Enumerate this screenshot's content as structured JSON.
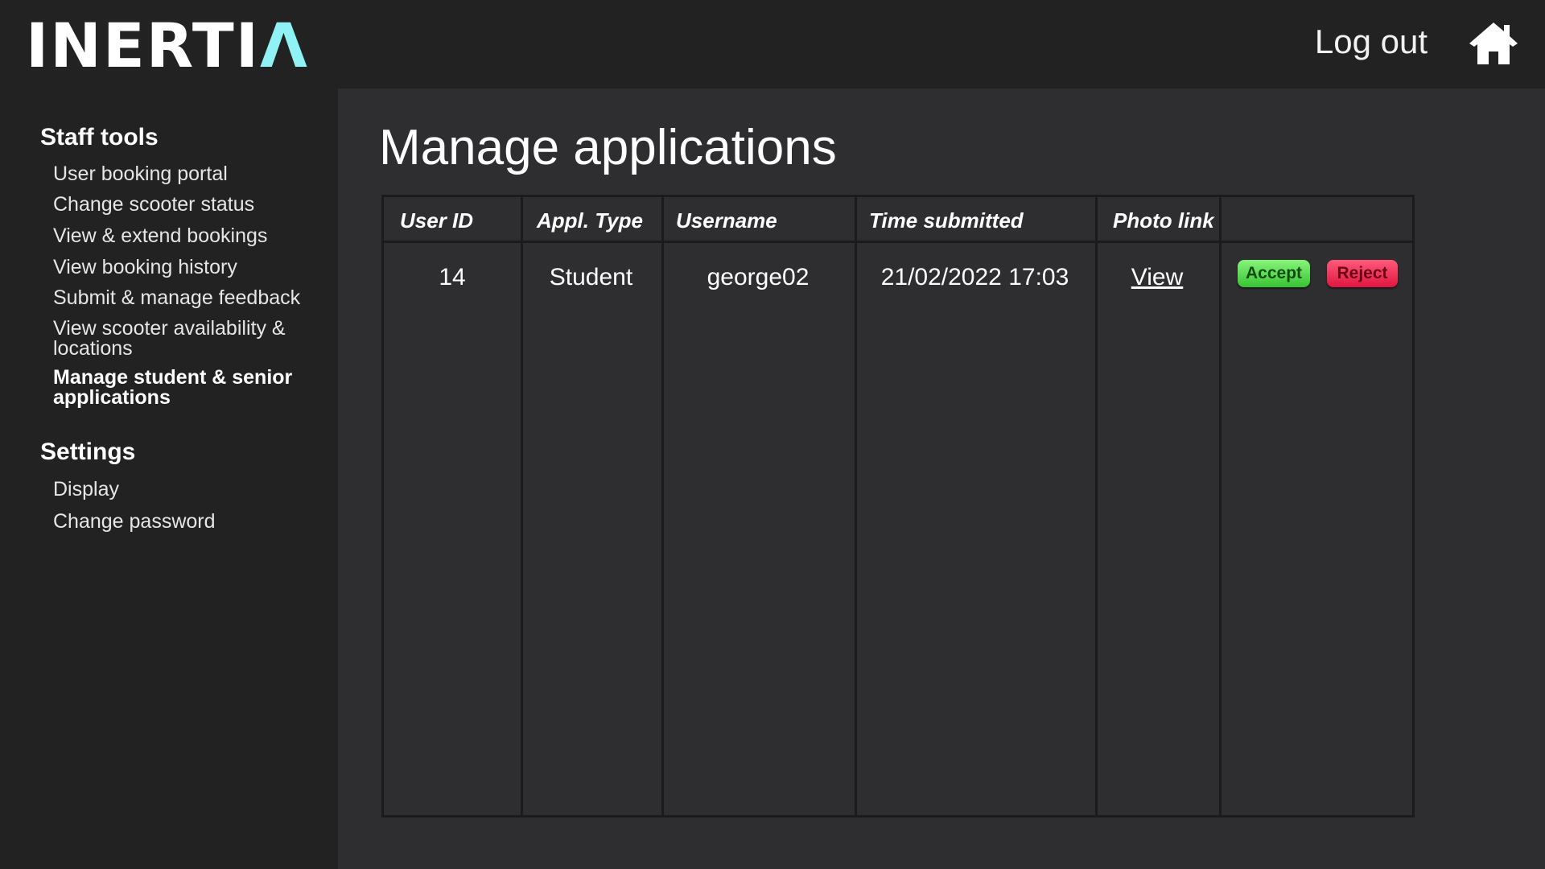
{
  "header": {
    "logo_main": "INERTI",
    "logo_accent": "Λ",
    "logout_label": "Log out",
    "home_icon": "home-icon",
    "accent_color": "#8ff3f5"
  },
  "sidebar": {
    "staff_tools_title": "Staff tools",
    "staff_items": [
      {
        "label": "User booking portal"
      },
      {
        "label": "Change scooter status"
      },
      {
        "label": "View & extend bookings"
      },
      {
        "label": "View booking history"
      },
      {
        "label": "Submit & manage feedback"
      },
      {
        "label": "View scooter availability & locations"
      },
      {
        "label": "Manage student & senior applications"
      }
    ],
    "settings_title": "Settings",
    "settings_items": [
      {
        "label": "Display"
      },
      {
        "label": "Change password"
      }
    ]
  },
  "main": {
    "title": "Manage applications",
    "table": {
      "headers": [
        "User ID",
        "Appl. Type",
        "Username",
        "Time submitted",
        "Photo link"
      ],
      "rows": [
        {
          "user_id": "14",
          "appl_type": "Student",
          "username": "george02",
          "time_submitted": "21/02/2022 17:03",
          "photo_link": "View",
          "accept_label": "Accept",
          "reject_label": "Reject"
        }
      ]
    }
  }
}
